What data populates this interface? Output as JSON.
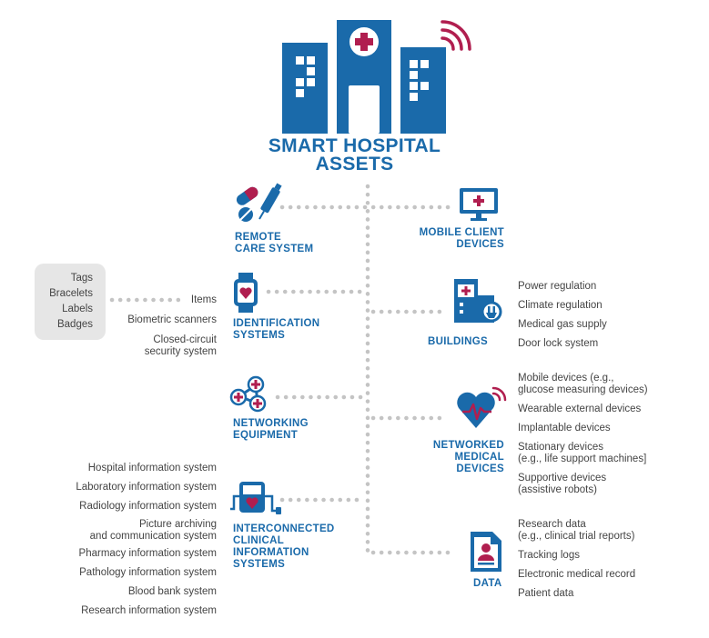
{
  "title": {
    "line1": "SMART HOSPITAL",
    "line2": "ASSETS"
  },
  "colors": {
    "blue": "#1a6aaa",
    "red": "#b01e4f",
    "gray_dots": "#c4c4c4",
    "text": "#444444"
  },
  "left": {
    "remote_care": {
      "label_lines": [
        "REMOTE",
        "CARE SYSTEM"
      ],
      "icon": "pills-syringe-icon"
    },
    "identification": {
      "label_lines": [
        "IDENTIFICATION",
        "SYSTEMS"
      ],
      "icon": "smartwatch-heart-icon",
      "items_label": "Items",
      "tag_box": [
        "Tags",
        "Bracelets",
        "Labels",
        "Badges"
      ],
      "others": [
        "Biometric scanners",
        "Closed-circuit",
        "security system"
      ]
    },
    "networking": {
      "label_lines": [
        "NETWORKING",
        "EQUIPMENT"
      ],
      "icon": "network-nodes-icon"
    },
    "clinical": {
      "label_lines": [
        "INTERCONNECTED",
        "CLINICAL",
        "INFORMATION",
        "SYSTEMS"
      ],
      "icon": "medical-device-icon",
      "items": [
        "Hospital information system",
        "Laboratory information system",
        "Radiology information system",
        "Picture archiving",
        "and communication system",
        "Pharmacy information system",
        "Pathology information system",
        "Blood bank system",
        "Research information system"
      ]
    }
  },
  "right": {
    "mobile": {
      "label_lines": [
        "MOBILE CLIENT",
        "DEVICES"
      ],
      "icon": "monitor-cross-icon"
    },
    "buildings": {
      "label": "BUILDINGS",
      "icon": "building-plug-icon",
      "items": [
        "Power regulation",
        "Climate regulation",
        "Medical gas supply",
        "Door lock system"
      ]
    },
    "medical": {
      "label_lines": [
        "NETWORKED",
        "MEDICAL",
        "DEVICES"
      ],
      "icon": "heart-wireless-icon",
      "items": [
        "Mobile devices (e.g.,",
        "glucose measuring devices)",
        "Wearable external devices",
        "Implantable devices",
        "Stationary devices",
        "(e.g., life support machines]",
        "Supportive devices",
        "(assistive robots)"
      ]
    },
    "data": {
      "label": "DATA",
      "icon": "document-person-icon",
      "items": [
        "Research data",
        "(e.g., clinical trial reports)",
        "Tracking logs",
        "Electronic medical record",
        "Patient data"
      ]
    }
  }
}
